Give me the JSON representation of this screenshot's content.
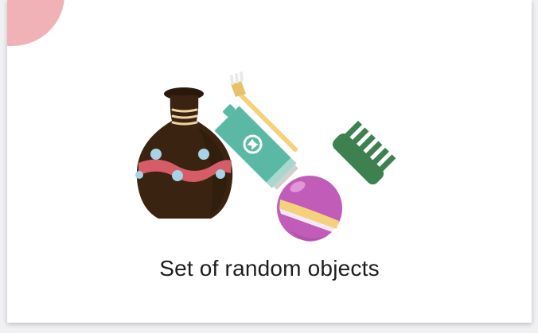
{
  "card": {
    "caption": "Set of random objects",
    "illustration": {
      "objects": [
        "vase-icon",
        "toothbrush-icon",
        "toothpaste-icon",
        "comb-icon",
        "ball-icon"
      ]
    }
  },
  "colors": {
    "corner_accent": "#f0b2b7",
    "vase_body": "#3b2311",
    "vase_band": "#d65c68",
    "vase_dots": "#a6d3e6",
    "toothbrush": "#f4d27b",
    "toothpaste": "#5ab9a5",
    "comb": "#3e8150",
    "ball": "#c25cb9"
  }
}
